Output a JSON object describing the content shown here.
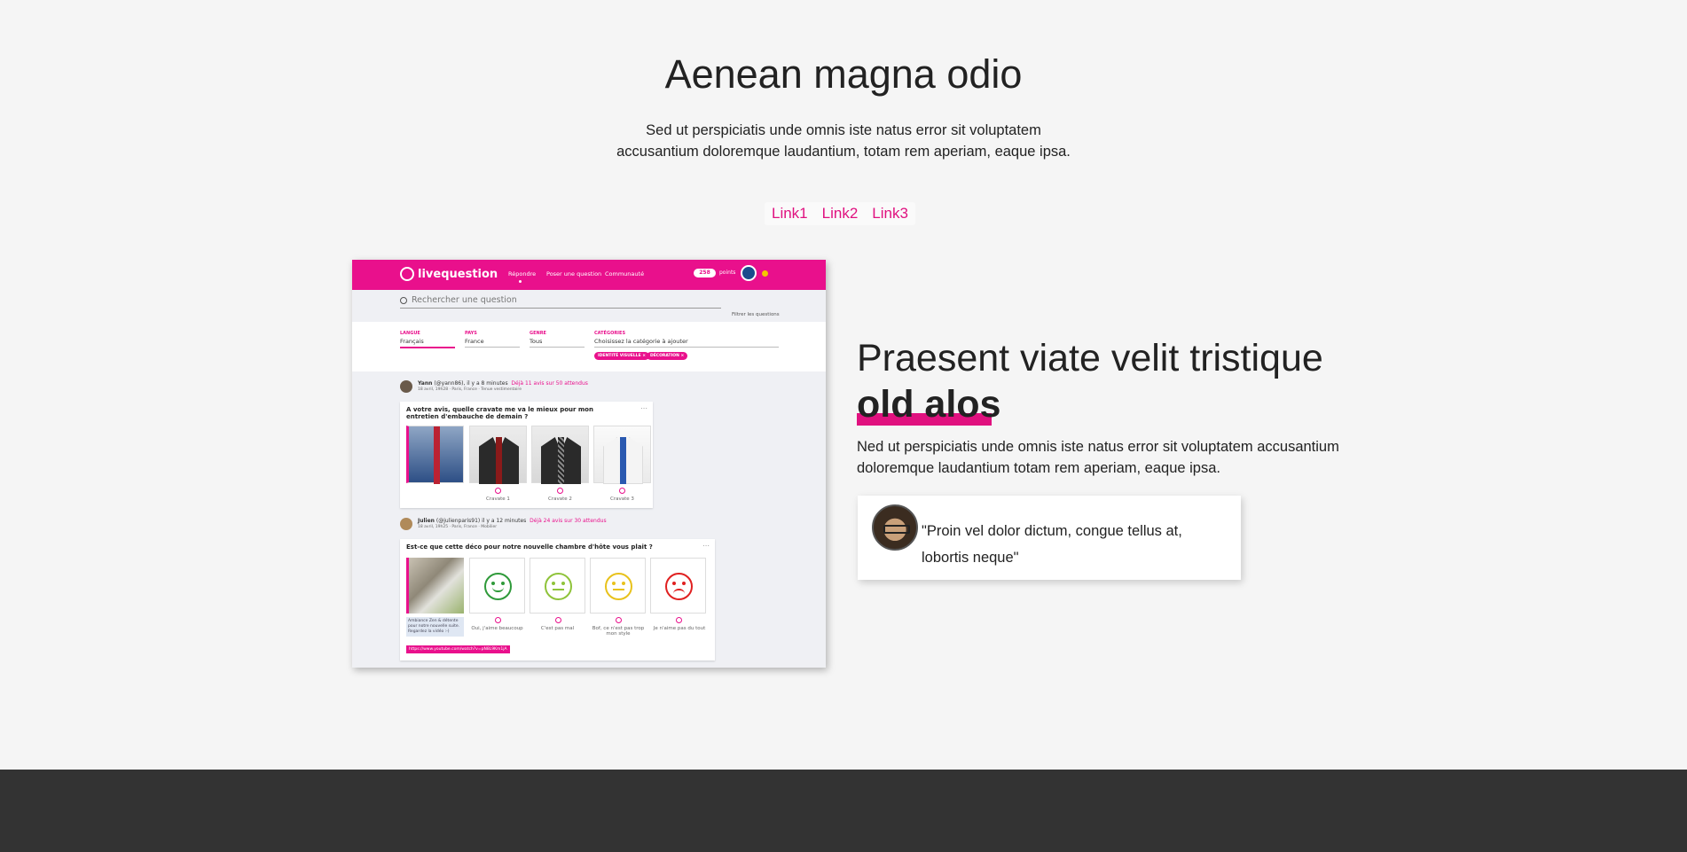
{
  "hero": {
    "title": "Aenean magna odio",
    "subtitle_line1": "Sed ut perspiciatis unde omnis iste natus error sit voluptatem",
    "subtitle_line2": "accusantium doloremque laudantium, totam rem aperiam, eaque ipsa."
  },
  "links": [
    "Link1",
    "Link2",
    "Link3"
  ],
  "colors": {
    "accent": "#e0117f",
    "app_bar": "#e9108c",
    "footer": "#333333",
    "background": "#f5f5f5"
  },
  "screenshot": {
    "brand": "livequestion",
    "nav": [
      "Répondre",
      "Poser une question",
      "Communauté"
    ],
    "points": "258",
    "points_label": "points",
    "search_placeholder": "Rechercher une question",
    "filter_label": "Filtrer les questions",
    "filters": {
      "langue_label": "LANGUE",
      "langue_value": "Français",
      "pays_label": "PAYS",
      "pays_value": "France",
      "genre_label": "GENRE",
      "genre_value": "Tous",
      "categories_label": "CATÉGORIES",
      "categories_value": "Choisissez la catégorie à ajouter"
    },
    "tags": [
      "IDENTITÉ VISUELLE ×",
      "DÉCORATION ×"
    ],
    "post1": {
      "author": "Yann",
      "handle": "(@yann86), il y a 8 minutes",
      "stats": "Déjà 11 avis sur 50 attendus",
      "meta": "18 avril, 19h28 · Paris, France · Tenue vestimentaire",
      "question": "A votre avis, quelle cravate me va le mieux pour mon entretien d'embauche de demain ?",
      "options": [
        "Cravate 1",
        "Cravate 2",
        "Cravate 3"
      ]
    },
    "post2": {
      "author": "Julien",
      "handle": "(@julienparis91) il y a 12 minutes",
      "stats": "Déjà 24 avis sur 30 attendus",
      "meta": "18 avril, 19h25 · Paris, France · Mobilier",
      "question": "Est-ce que cette déco pour notre nouvelle chambre d'hôte vous plait ?",
      "note": "Ambiance Zen & détente pour notre nouvelle suite. Regardez la vidéo :-)",
      "link": "https://www.youtube.com/watch?v=pN8L9Km1jA",
      "options": [
        "Oui, j'aime beaucoup",
        "C'est pas mal",
        "Bof, ce n'est pas trop mon style",
        "Je n'aime pas du tout"
      ]
    }
  },
  "feature": {
    "title_line1": "Praesent viate velit tristique",
    "title_line2": "old alos",
    "description": "Ned ut perspiciatis unde omnis iste natus error sit voluptatem accusantium doloremque laudantium totam rem aperiam, eaque ipsa.",
    "quote": "\"Proin vel dolor dictum, congue tellus at, lobortis neque\""
  }
}
